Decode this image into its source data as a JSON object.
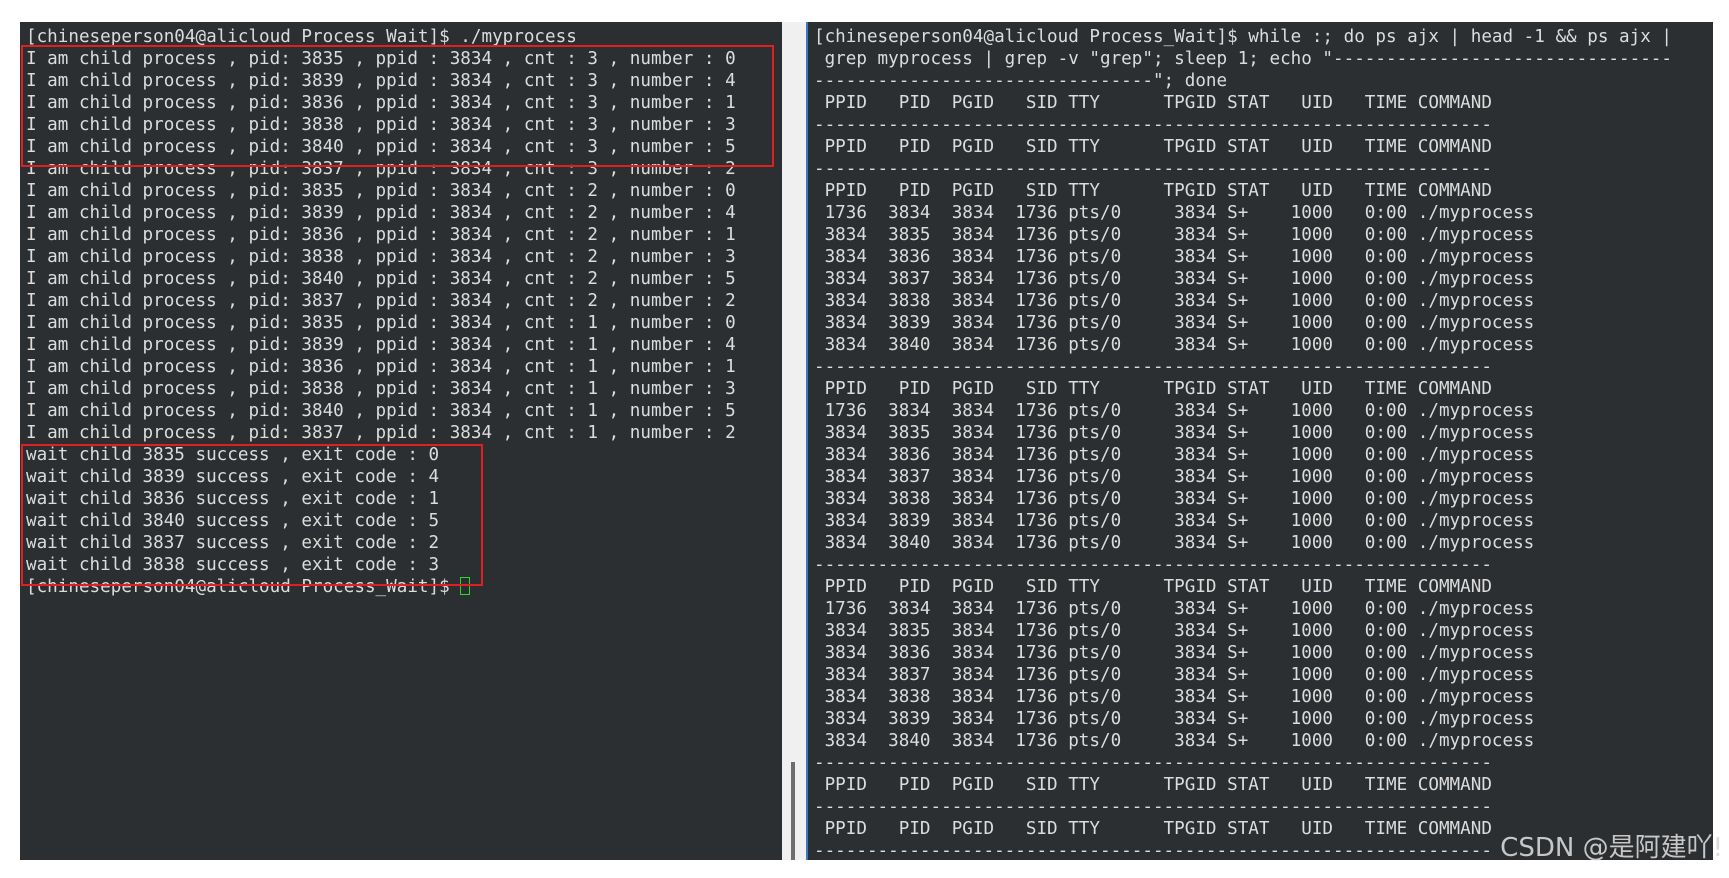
{
  "left_terminal": {
    "lines": [
      "[chineseperson04@alicloud Process_Wait]$ ./myprocess",
      "I am child process , pid: 3835 , ppid : 3834 , cnt : 3 , number : 0",
      "I am child process , pid: 3839 , ppid : 3834 , cnt : 3 , number : 4",
      "I am child process , pid: 3836 , ppid : 3834 , cnt : 3 , number : 1",
      "I am child process , pid: 3838 , ppid : 3834 , cnt : 3 , number : 3",
      "I am child process , pid: 3840 , ppid : 3834 , cnt : 3 , number : 5",
      "I am child process , pid: 3837 , ppid : 3834 , cnt : 3 , number : 2",
      "I am child process , pid: 3835 , ppid : 3834 , cnt : 2 , number : 0",
      "I am child process , pid: 3839 , ppid : 3834 , cnt : 2 , number : 4",
      "I am child process , pid: 3836 , ppid : 3834 , cnt : 2 , number : 1",
      "I am child process , pid: 3838 , ppid : 3834 , cnt : 2 , number : 3",
      "I am child process , pid: 3840 , ppid : 3834 , cnt : 2 , number : 5",
      "I am child process , pid: 3837 , ppid : 3834 , cnt : 2 , number : 2",
      "I am child process , pid: 3835 , ppid : 3834 , cnt : 1 , number : 0",
      "I am child process , pid: 3839 , ppid : 3834 , cnt : 1 , number : 4",
      "I am child process , pid: 3836 , ppid : 3834 , cnt : 1 , number : 1",
      "I am child process , pid: 3838 , ppid : 3834 , cnt : 1 , number : 3",
      "I am child process , pid: 3840 , ppid : 3834 , cnt : 1 , number : 5",
      "I am child process , pid: 3837 , ppid : 3834 , cnt : 1 , number : 2",
      "wait child 3835 success , exit code : 0",
      "wait child 3839 success , exit code : 4",
      "wait child 3836 success , exit code : 1",
      "wait child 3840 success , exit code : 5",
      "wait child 3837 success , exit code : 2",
      "wait child 3838 success , exit code : 3"
    ],
    "prompt": "[chineseperson04@alicloud Process_Wait]$ "
  },
  "right_terminal": {
    "lines": [
      "[chineseperson04@alicloud Process_Wait]$ while :; do ps ajx | head -1 && ps ajx |",
      " grep myprocess | grep -v \"grep\"; sleep 1; echo \"--------------------------------",
      "--------------------------------\"; done",
      " PPID   PID  PGID   SID TTY      TPGID STAT   UID   TIME COMMAND",
      "----------------------------------------------------------------",
      " PPID   PID  PGID   SID TTY      TPGID STAT   UID   TIME COMMAND",
      "----------------------------------------------------------------",
      " PPID   PID  PGID   SID TTY      TPGID STAT   UID   TIME COMMAND",
      " 1736  3834  3834  1736 pts/0     3834 S+    1000   0:00 ./myprocess",
      " 3834  3835  3834  1736 pts/0     3834 S+    1000   0:00 ./myprocess",
      " 3834  3836  3834  1736 pts/0     3834 S+    1000   0:00 ./myprocess",
      " 3834  3837  3834  1736 pts/0     3834 S+    1000   0:00 ./myprocess",
      " 3834  3838  3834  1736 pts/0     3834 S+    1000   0:00 ./myprocess",
      " 3834  3839  3834  1736 pts/0     3834 S+    1000   0:00 ./myprocess",
      " 3834  3840  3834  1736 pts/0     3834 S+    1000   0:00 ./myprocess",
      "----------------------------------------------------------------",
      " PPID   PID  PGID   SID TTY      TPGID STAT   UID   TIME COMMAND",
      " 1736  3834  3834  1736 pts/0     3834 S+    1000   0:00 ./myprocess",
      " 3834  3835  3834  1736 pts/0     3834 S+    1000   0:00 ./myprocess",
      " 3834  3836  3834  1736 pts/0     3834 S+    1000   0:00 ./myprocess",
      " 3834  3837  3834  1736 pts/0     3834 S+    1000   0:00 ./myprocess",
      " 3834  3838  3834  1736 pts/0     3834 S+    1000   0:00 ./myprocess",
      " 3834  3839  3834  1736 pts/0     3834 S+    1000   0:00 ./myprocess",
      " 3834  3840  3834  1736 pts/0     3834 S+    1000   0:00 ./myprocess",
      "----------------------------------------------------------------",
      " PPID   PID  PGID   SID TTY      TPGID STAT   UID   TIME COMMAND",
      " 1736  3834  3834  1736 pts/0     3834 S+    1000   0:00 ./myprocess",
      " 3834  3835  3834  1736 pts/0     3834 S+    1000   0:00 ./myprocess",
      " 3834  3836  3834  1736 pts/0     3834 S+    1000   0:00 ./myprocess",
      " 3834  3837  3834  1736 pts/0     3834 S+    1000   0:00 ./myprocess",
      " 3834  3838  3834  1736 pts/0     3834 S+    1000   0:00 ./myprocess",
      " 3834  3839  3834  1736 pts/0     3834 S+    1000   0:00 ./myprocess",
      " 3834  3840  3834  1736 pts/0     3834 S+    1000   0:00 ./myprocess",
      "----------------------------------------------------------------",
      " PPID   PID  PGID   SID TTY      TPGID STAT   UID   TIME COMMAND",
      "----------------------------------------------------------------",
      " PPID   PID  PGID   SID TTY      TPGID STAT   UID   TIME COMMAND",
      "----------------------------------------------------------------"
    ]
  },
  "watermark": "CSDN @是阿建吖!",
  "colors": {
    "terminal_bg": "#2b2f31",
    "terminal_fg": "#dcdcdc",
    "highlight_box": "#e02020",
    "cursor": "#2bd82b"
  }
}
